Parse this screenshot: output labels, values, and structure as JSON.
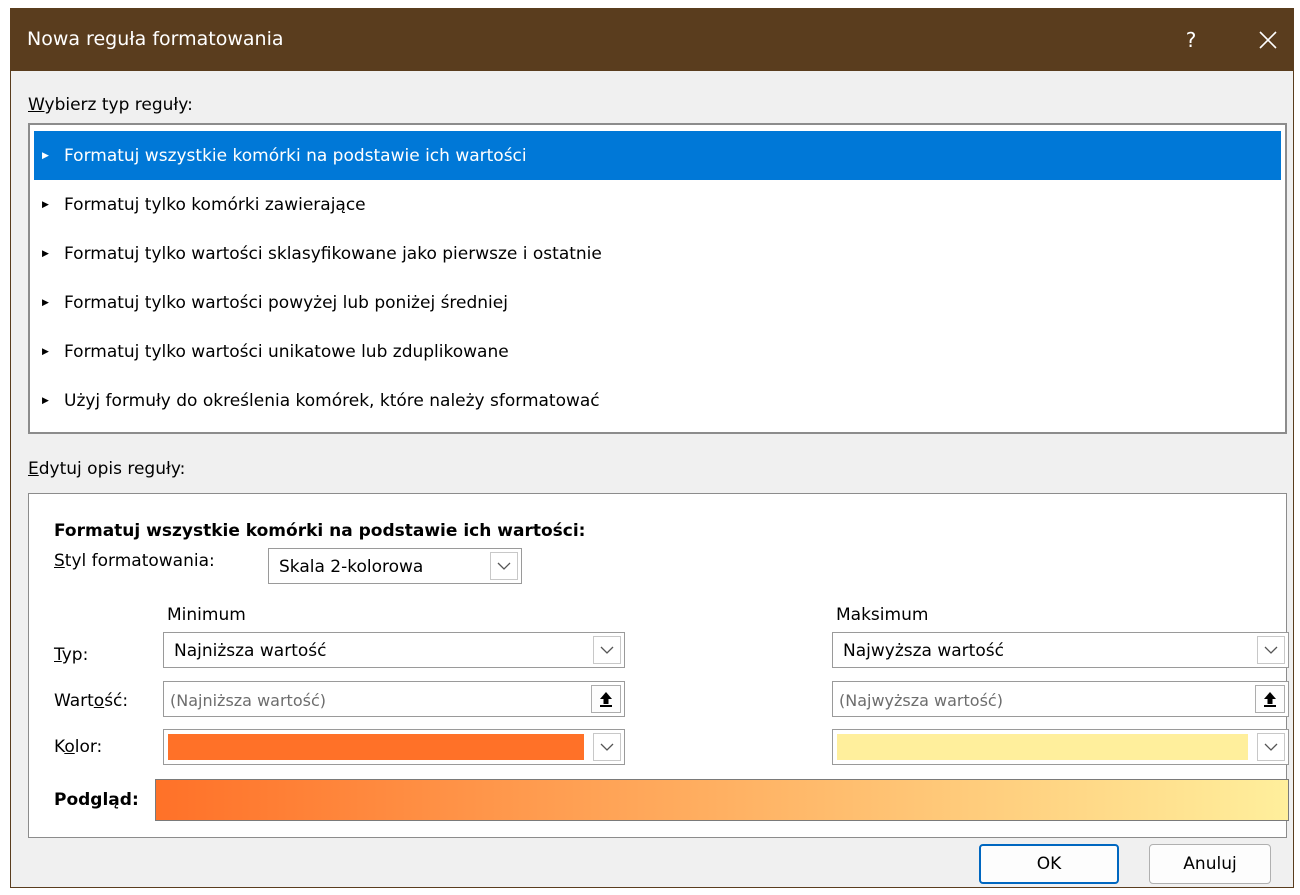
{
  "window": {
    "title": "Nowa reguła formatowania",
    "help": "?"
  },
  "rule_type": {
    "label_key": "W",
    "label_rest": "ybierz typ reguły:",
    "items": [
      {
        "label": "Formatuj wszystkie komórki na podstawie ich wartości",
        "selected": true
      },
      {
        "label": "Formatuj tylko komórki zawierające",
        "selected": false
      },
      {
        "label": "Formatuj tylko wartości sklasyfikowane jako pierwsze i ostatnie",
        "selected": false
      },
      {
        "label": "Formatuj tylko wartości powyżej lub poniżej średniej",
        "selected": false
      },
      {
        "label": "Formatuj tylko wartości unikatowe lub zduplikowane",
        "selected": false
      },
      {
        "label": "Użyj formuły do określenia komórek, które należy sformatować",
        "selected": false
      }
    ]
  },
  "description": {
    "label_key": "E",
    "label_rest": "dytuj opis reguły:",
    "heading": "Formatuj wszystkie komórki na podstawie ich wartości:",
    "style_label_key": "S",
    "style_label_rest": "tyl formatowania:",
    "style_value": "Skala 2-kolorowa",
    "minimum_header": "Minimum",
    "maximum_header": "Maksimum",
    "type_label_key": "T",
    "type_label_rest": "yp:",
    "value_label_pre": "Wart",
    "value_label_key": "o",
    "value_label_post": "ść:",
    "color_label_pre": "K",
    "color_label_key": "o",
    "color_label_post": "lor:",
    "min_type": "Najniższa wartość",
    "max_type": "Najwyższa wartość",
    "min_value_placeholder": "(Najniższa wartość)",
    "max_value_placeholder": "(Najwyższa wartość)",
    "min_color": "#ff7128",
    "max_color": "#ffef9c",
    "preview_label": "Podgląd:"
  },
  "buttons": {
    "ok": "OK",
    "cancel": "Anuluj"
  }
}
